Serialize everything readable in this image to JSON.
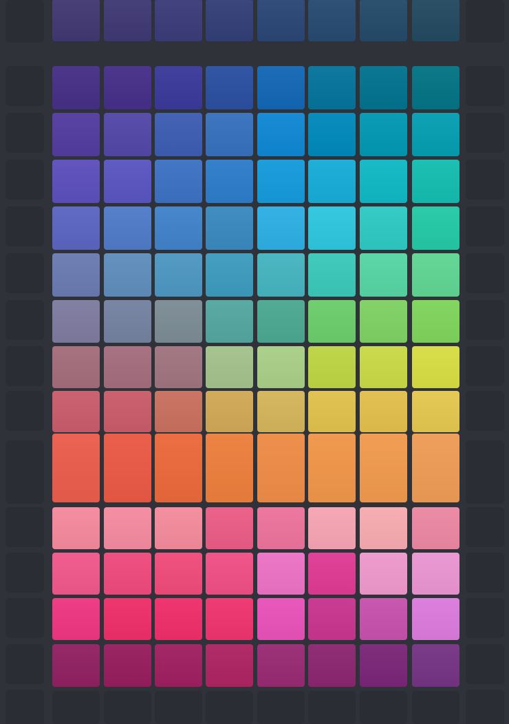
{
  "puzzle": {
    "columns": 8,
    "board_background": "#2f3238",
    "empty_cell_color": "#2a2d33",
    "rows": [
      [
        "#413872",
        "#3f3873",
        "#3b3b79",
        "#323f77",
        "#2b4676",
        "#264a70",
        "#244a68",
        "#234a60"
      ],
      [
        "#462f86",
        "#452f89",
        "#3a399a",
        "#2b4fa0",
        "#1367b5",
        "#06739b",
        "#02728e",
        "#037384"
      ],
      [
        "#523ca0",
        "#5347a7",
        "#3d5db3",
        "#3671bc",
        "#0f87d3",
        "#0089ba",
        "#0298b2",
        "#049eb1"
      ],
      [
        "#5c4fbc",
        "#5a55c1",
        "#3c72c3",
        "#2e7cc9",
        "#159bdb",
        "#16acd6",
        "#10b8c5",
        "#14bdb0"
      ],
      [
        "#5b65c0",
        "#4f7bc7",
        "#4182c9",
        "#3a88be",
        "#2dafe2",
        "#2ec6de",
        "#2ec9c3",
        "#24c9a5"
      ],
      [
        "#6a7ab1",
        "#5f8dbc",
        "#4d97c2",
        "#3d9bbd",
        "#45b4bf",
        "#3ac9ba",
        "#56d5a3",
        "#60d592"
      ],
      [
        "#7e7b9f",
        "#7482a0",
        "#7c8c94",
        "#54a7a0",
        "#4ba891",
        "#6ccd6b",
        "#7fd163",
        "#7fd45c"
      ],
      [
        "#a36d7c",
        "#a46d7d",
        "#a07480",
        "#a4c18b",
        "#a9cf87",
        "#bdd444",
        "#c8d945",
        "#d6dd42"
      ],
      [
        "#c95c6c",
        "#c95c69",
        "#c9705f",
        "#d1a857",
        "#d3b55a",
        "#e0c14c",
        "#e2bf4c",
        "#e4c74f"
      ],
      [
        "#ef5f4e",
        "#ef5b45",
        "#f06b3d",
        "#f1823e",
        "#f38f48",
        "#f5984b",
        "#f69d50",
        "#f29f57"
      ],
      [
        "#f4899c",
        "#f48ba0",
        "#f48b9c",
        "#ea5c86",
        "#ec739c",
        "#f5a4b3",
        "#f6abb0",
        "#ec87a2"
      ],
      [
        "#f0588b",
        "#ef4a7e",
        "#f04b7a",
        "#ef4f85",
        "#ec72c5",
        "#de3b93",
        "#ee98cd",
        "#ea95d1"
      ],
      [
        "#ee3681",
        "#ee2f69",
        "#ef2e6a",
        "#ef346f",
        "#e852b8",
        "#c8358f",
        "#c652ac",
        "#da7bdb"
      ],
      [
        "#912162",
        "#961e5e",
        "#9e1f60",
        "#ad2462",
        "#982a72",
        "#8b2670",
        "#792677",
        "#753383"
      ]
    ]
  }
}
